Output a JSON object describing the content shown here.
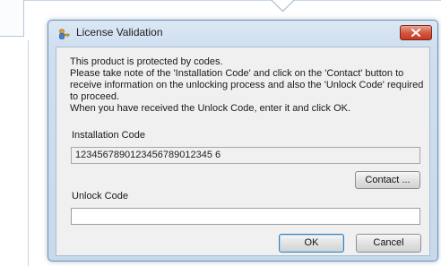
{
  "window": {
    "title": "License Validation",
    "icon": "key-person-icon"
  },
  "message": {
    "lines": [
      "This product is protected by codes.",
      "Please take note of the 'Installation Code' and click on the 'Contact' button to",
      "receive information on the unlocking process and also the 'Unlock Code' required",
      "to proceed.",
      "When you have received the Unlock Code, enter it and click OK."
    ]
  },
  "installation": {
    "label": "Installation Code",
    "value": "1234567890123456789012345 6"
  },
  "contact": {
    "label": "Contact ..."
  },
  "unlock": {
    "label": "Unlock Code",
    "value": ""
  },
  "buttons": {
    "ok": "OK",
    "cancel": "Cancel"
  },
  "colors": {
    "close": "#d5593f",
    "frame": "#c8d9ec"
  }
}
